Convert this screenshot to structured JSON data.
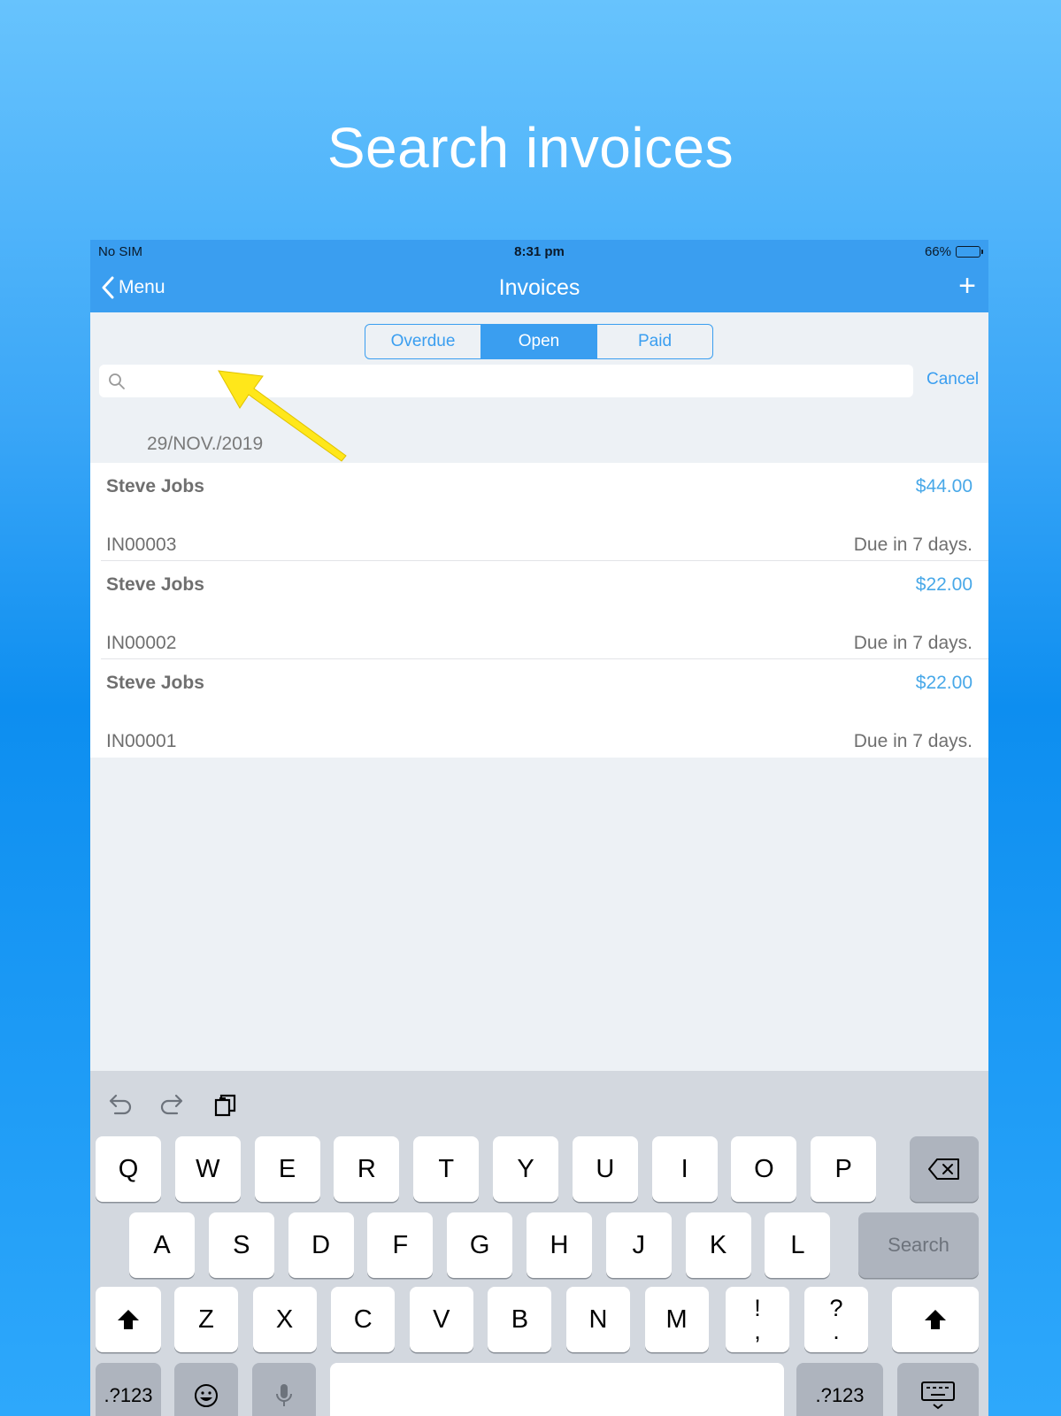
{
  "headline": "Search invoices",
  "status": {
    "carrier": "No SIM",
    "time": "8:31 pm",
    "battery": "66%",
    "battery_level": 0.66
  },
  "nav": {
    "back_label": "Menu",
    "title": "Invoices",
    "add_label": "+"
  },
  "segments": [
    {
      "label": "Overdue",
      "active": false
    },
    {
      "label": "Open",
      "active": true
    },
    {
      "label": "Paid",
      "active": false
    }
  ],
  "search": {
    "placeholder": "",
    "cancel_label": "Cancel"
  },
  "section_date": "29/NOV./2019",
  "invoices": [
    {
      "name": "Steve Jobs",
      "amount": "$44.00",
      "number": "IN00003",
      "due": "Due in 7 days."
    },
    {
      "name": "Steve Jobs",
      "amount": "$22.00",
      "number": "IN00002",
      "due": "Due in 7 days."
    },
    {
      "name": "Steve Jobs",
      "amount": "$22.00",
      "number": "IN00001",
      "due": "Due in 7 days."
    }
  ],
  "keyboard": {
    "row1": [
      "Q",
      "W",
      "E",
      "R",
      "T",
      "Y",
      "U",
      "I",
      "O",
      "P"
    ],
    "row2": [
      "A",
      "S",
      "D",
      "F",
      "G",
      "H",
      "J",
      "K",
      "L"
    ],
    "row3": [
      "Z",
      "X",
      "C",
      "V",
      "B",
      "N",
      "M"
    ],
    "punct1": {
      "top": "!",
      "bottom": ","
    },
    "punct2": {
      "top": "?",
      "bottom": "."
    },
    "search_label": "Search",
    "numbers_label": ".?123"
  },
  "colors": {
    "accent": "#3a9ef0",
    "annotation_arrow": "#ffe71a"
  }
}
